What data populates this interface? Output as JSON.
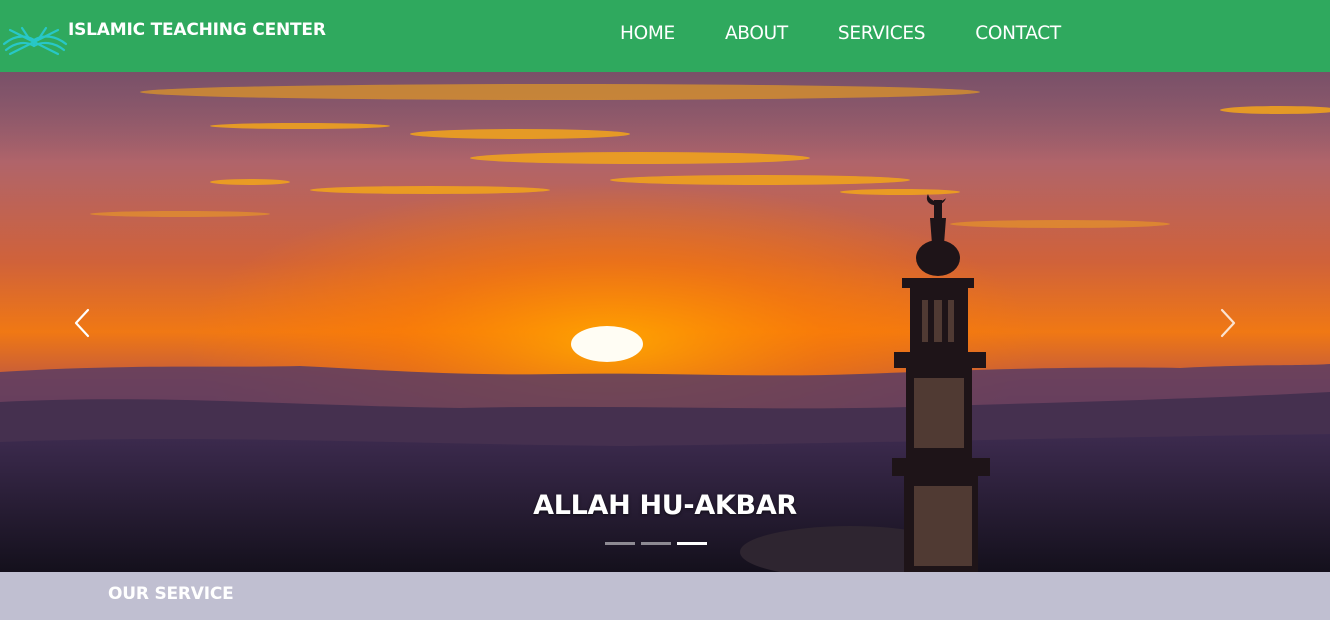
{
  "brand": {
    "name": "ISLAMIC TEACHING CENTER",
    "logo_icon": "quran-book-icon"
  },
  "nav": {
    "items": [
      {
        "label": "HOME"
      },
      {
        "label": "ABOUT"
      },
      {
        "label": "SERVICES"
      },
      {
        "label": "CONTACT"
      }
    ]
  },
  "carousel": {
    "caption": "ALLAH HU-AKBAR",
    "prev_icon": "chevron-left-icon",
    "next_icon": "chevron-right-icon",
    "slide_count": 3,
    "active_slide": 3
  },
  "section": {
    "title": "OUR SERVICE"
  },
  "colors": {
    "navbar": "#2fa95e",
    "section_strip": "#c0bfd1",
    "logo": "#28c7c7"
  }
}
